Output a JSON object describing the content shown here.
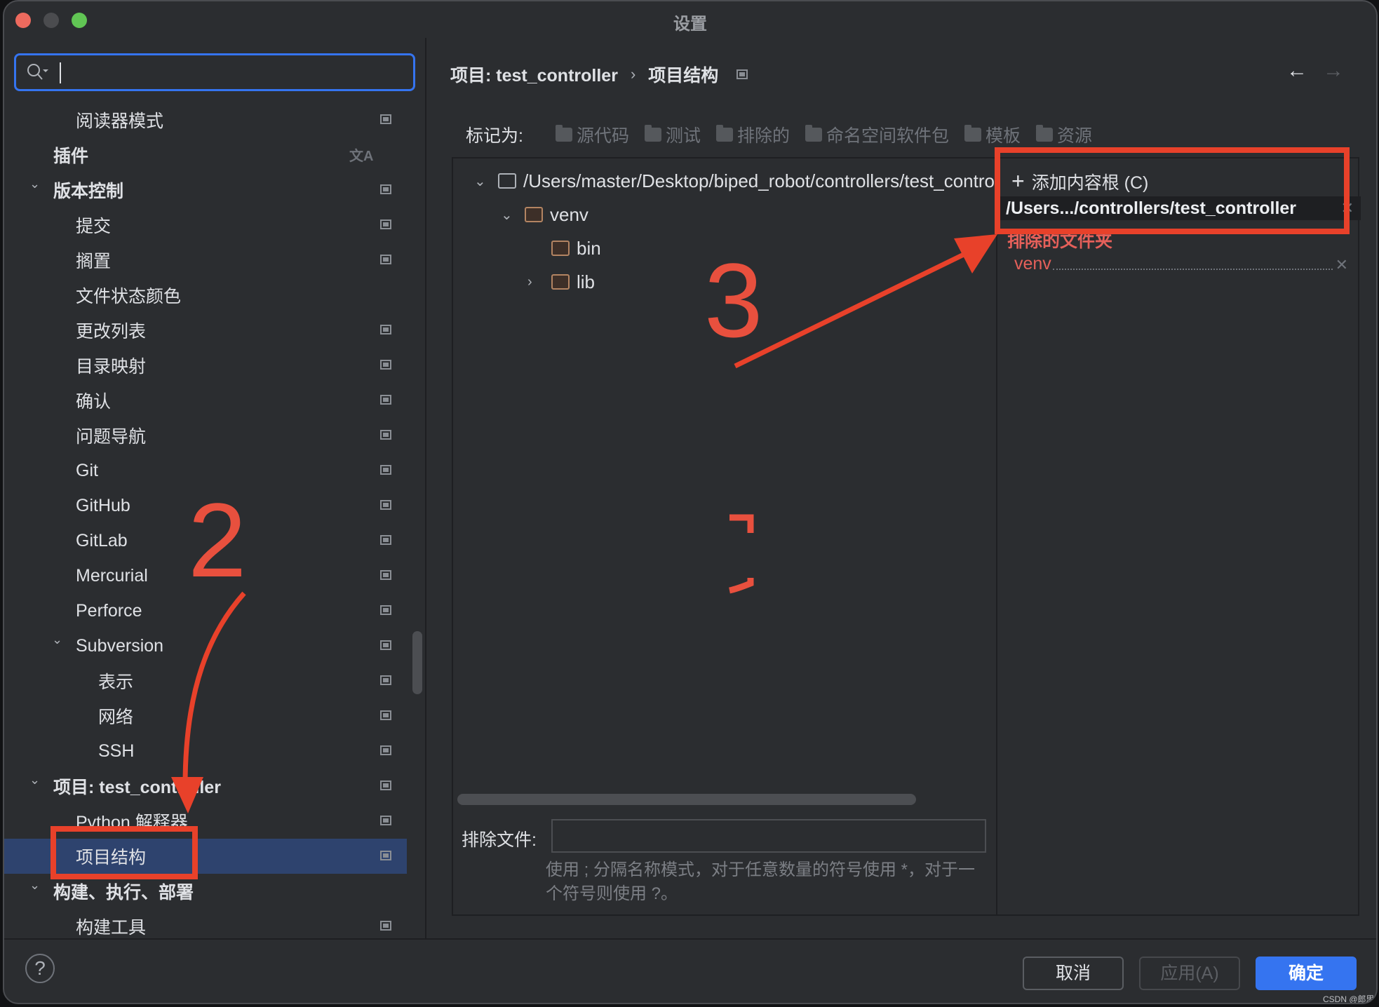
{
  "window": {
    "title": "设置"
  },
  "sidebar": {
    "search": {
      "value": "",
      "placeholder": ""
    },
    "items": [
      {
        "label": "阅读器模式",
        "level": 2,
        "bold": false,
        "expandable": false,
        "icon": "pin"
      },
      {
        "label": "插件",
        "level": 1,
        "bold": true,
        "expandable": false,
        "icon": "translate"
      },
      {
        "label": "版本控制",
        "level": 1,
        "bold": true,
        "expandable": true,
        "icon": "pin"
      },
      {
        "label": "提交",
        "level": 2,
        "bold": false,
        "expandable": false,
        "icon": "pin"
      },
      {
        "label": "搁置",
        "level": 2,
        "bold": false,
        "expandable": false,
        "icon": "pin"
      },
      {
        "label": "文件状态颜色",
        "level": 2,
        "bold": false,
        "expandable": false,
        "icon": ""
      },
      {
        "label": "更改列表",
        "level": 2,
        "bold": false,
        "expandable": false,
        "icon": "pin"
      },
      {
        "label": "目录映射",
        "level": 2,
        "bold": false,
        "expandable": false,
        "icon": "pin"
      },
      {
        "label": "确认",
        "level": 2,
        "bold": false,
        "expandable": false,
        "icon": "pin"
      },
      {
        "label": "问题导航",
        "level": 2,
        "bold": false,
        "expandable": false,
        "icon": "pin"
      },
      {
        "label": "Git",
        "level": 2,
        "bold": false,
        "expandable": false,
        "icon": "pin"
      },
      {
        "label": "GitHub",
        "level": 2,
        "bold": false,
        "expandable": false,
        "icon": "pin"
      },
      {
        "label": "GitLab",
        "level": 2,
        "bold": false,
        "expandable": false,
        "icon": "pin"
      },
      {
        "label": "Mercurial",
        "level": 2,
        "bold": false,
        "expandable": false,
        "icon": "pin"
      },
      {
        "label": "Perforce",
        "level": 2,
        "bold": false,
        "expandable": false,
        "icon": "pin"
      },
      {
        "label": "Subversion",
        "level": 2,
        "bold": false,
        "expandable": true,
        "icon": "pin"
      },
      {
        "label": "表示",
        "level": 3,
        "bold": false,
        "expandable": false,
        "icon": "pin"
      },
      {
        "label": "网络",
        "level": 3,
        "bold": false,
        "expandable": false,
        "icon": "pin"
      },
      {
        "label": "SSH",
        "level": 3,
        "bold": false,
        "expandable": false,
        "icon": "pin"
      },
      {
        "label": "项目: test_controller",
        "level": 1,
        "bold": true,
        "expandable": true,
        "icon": "pin"
      },
      {
        "label": "Python 解释器",
        "level": 2,
        "bold": false,
        "expandable": false,
        "icon": "pin"
      },
      {
        "label": "项目结构",
        "level": 2,
        "bold": false,
        "expandable": false,
        "icon": "pin",
        "selected": true
      },
      {
        "label": "构建、执行、部署",
        "level": 1,
        "bold": true,
        "expandable": true,
        "icon": ""
      },
      {
        "label": "构建工具",
        "level": 2,
        "bold": false,
        "expandable": false,
        "icon": "pin"
      }
    ]
  },
  "main": {
    "breadcrumb": {
      "parent": "项目: test_controller",
      "separator": "›",
      "current": "项目结构"
    },
    "nav": {
      "back": "←",
      "forward": "→"
    },
    "mark_as": {
      "label": "标记为:",
      "buttons": [
        "源代码",
        "测试",
        "排除的",
        "命名空间软件包",
        "模板",
        "资源"
      ]
    },
    "tree": [
      {
        "label": "/Users/master/Desktop/biped_robot/controllers/test_controller",
        "depth": 0,
        "chevron": "down",
        "folder": "grey"
      },
      {
        "label": "venv",
        "depth": 1,
        "chevron": "down",
        "folder": "excluded"
      },
      {
        "label": "bin",
        "depth": 2,
        "chevron": "",
        "folder": "excluded"
      },
      {
        "label": "lib",
        "depth": 2,
        "chevron": "right",
        "folder": "excluded"
      }
    ],
    "exclude_files": {
      "label": "排除文件:",
      "value": "",
      "hint": "使用 ; 分隔名称模式，对于任意数量的符号使用 *，对于一个符号则使用 ?。"
    },
    "roots": {
      "add_label": "添加内容根 (C)",
      "root_path": "/Users.../controllers/test_controller",
      "excluded_header": "排除的文件夹",
      "excluded_items": [
        "venv"
      ]
    }
  },
  "footer": {
    "help": "?",
    "cancel": "取消",
    "apply": "应用(A)",
    "ok": "确定",
    "watermark": "CSDN @郎思"
  },
  "annotations": {
    "color": "#e8412a",
    "labels": [
      "2",
      "3"
    ]
  }
}
